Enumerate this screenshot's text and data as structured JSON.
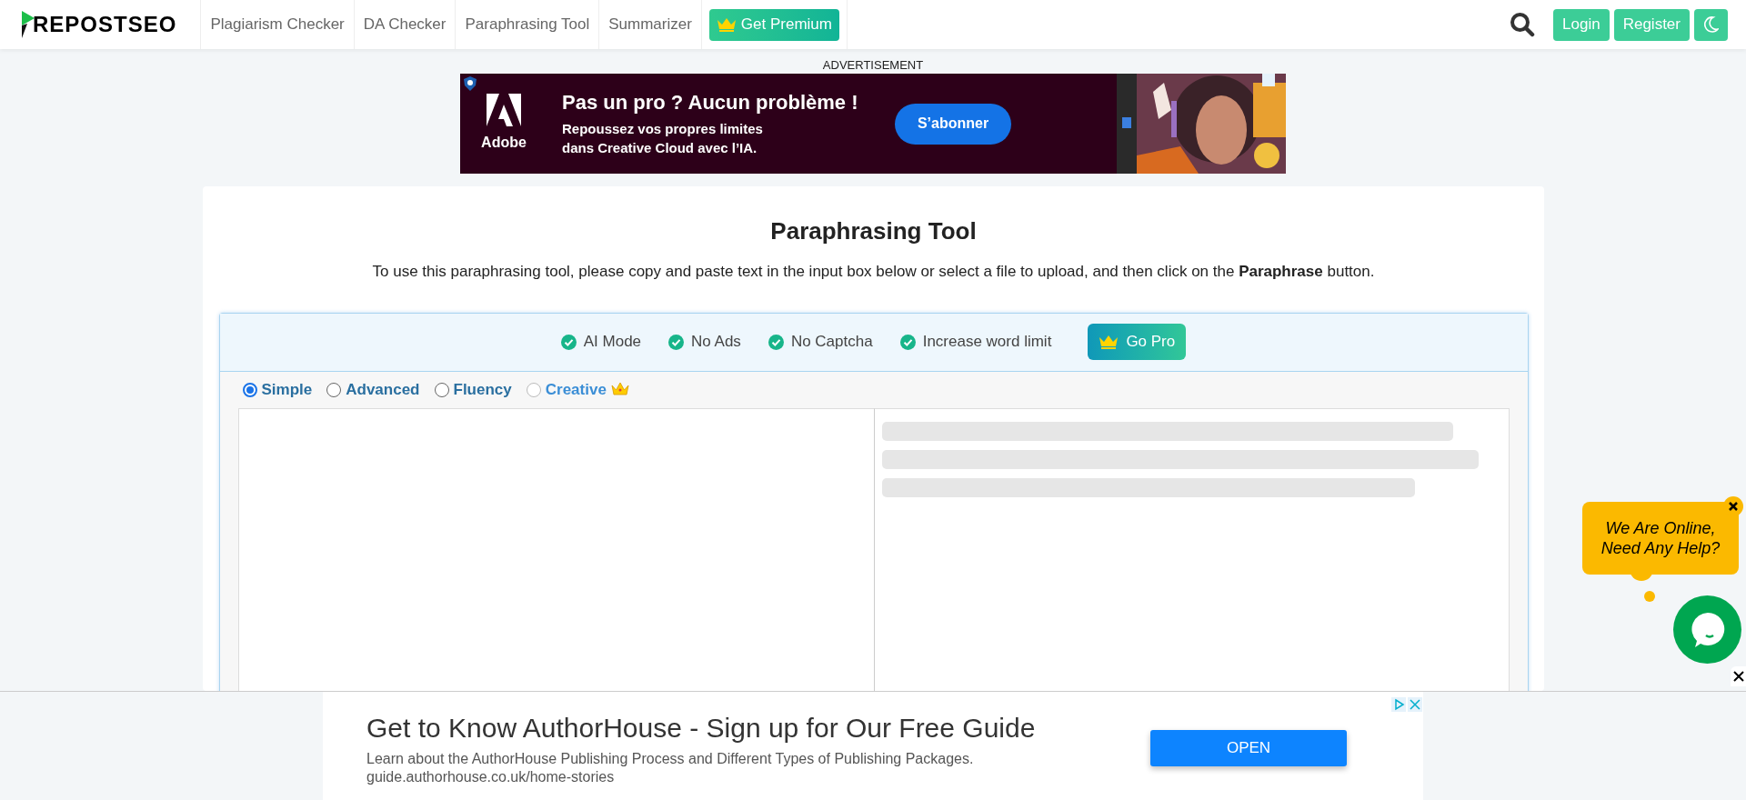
{
  "header": {
    "logo": "REPOSTSEO",
    "nav": [
      "Plagiarism Checker",
      "DA Checker",
      "Paraphrasing Tool",
      "Summarizer"
    ],
    "premium_button": "Get Premium",
    "buttons": [
      "Login",
      "Register"
    ]
  },
  "top_ad": {
    "label": "ADVERTISEMENT",
    "brand": "Adobe",
    "headline": "Pas un pro ? Aucun problème !",
    "text": "Repoussez vos propres limites dans Creative Cloud avec l’IA.",
    "button": "S’abonner"
  },
  "tool": {
    "title": "Paraphrasing Tool",
    "description": "To use this paraphrasing tool, please copy and paste text in the input box below or select a file to upload, and then click on the **Paraphrase** button.",
    "features": [
      "AI Mode",
      "No Ads",
      "No Captcha",
      "Increase word limit"
    ],
    "go_pro": "Go Pro",
    "modes": [
      {
        "label": "Simple",
        "selected": true,
        "premium": false
      },
      {
        "label": "Advanced",
        "selected": false,
        "premium": false
      },
      {
        "label": "Fluency",
        "selected": false,
        "premium": false
      },
      {
        "label": "Creative",
        "selected": false,
        "premium": true
      }
    ]
  },
  "chat": {
    "message": "We Are Online, Need Any Help?"
  },
  "bottom_ad": {
    "title": "Get to Know AuthorHouse - Sign up for Our Free Guide",
    "text": "Learn about the AuthorHouse Publishing Process and Different Types of Publishing Packages.",
    "url": "guide.authorhouse.co.uk/home-stories",
    "button": "OPEN"
  }
}
